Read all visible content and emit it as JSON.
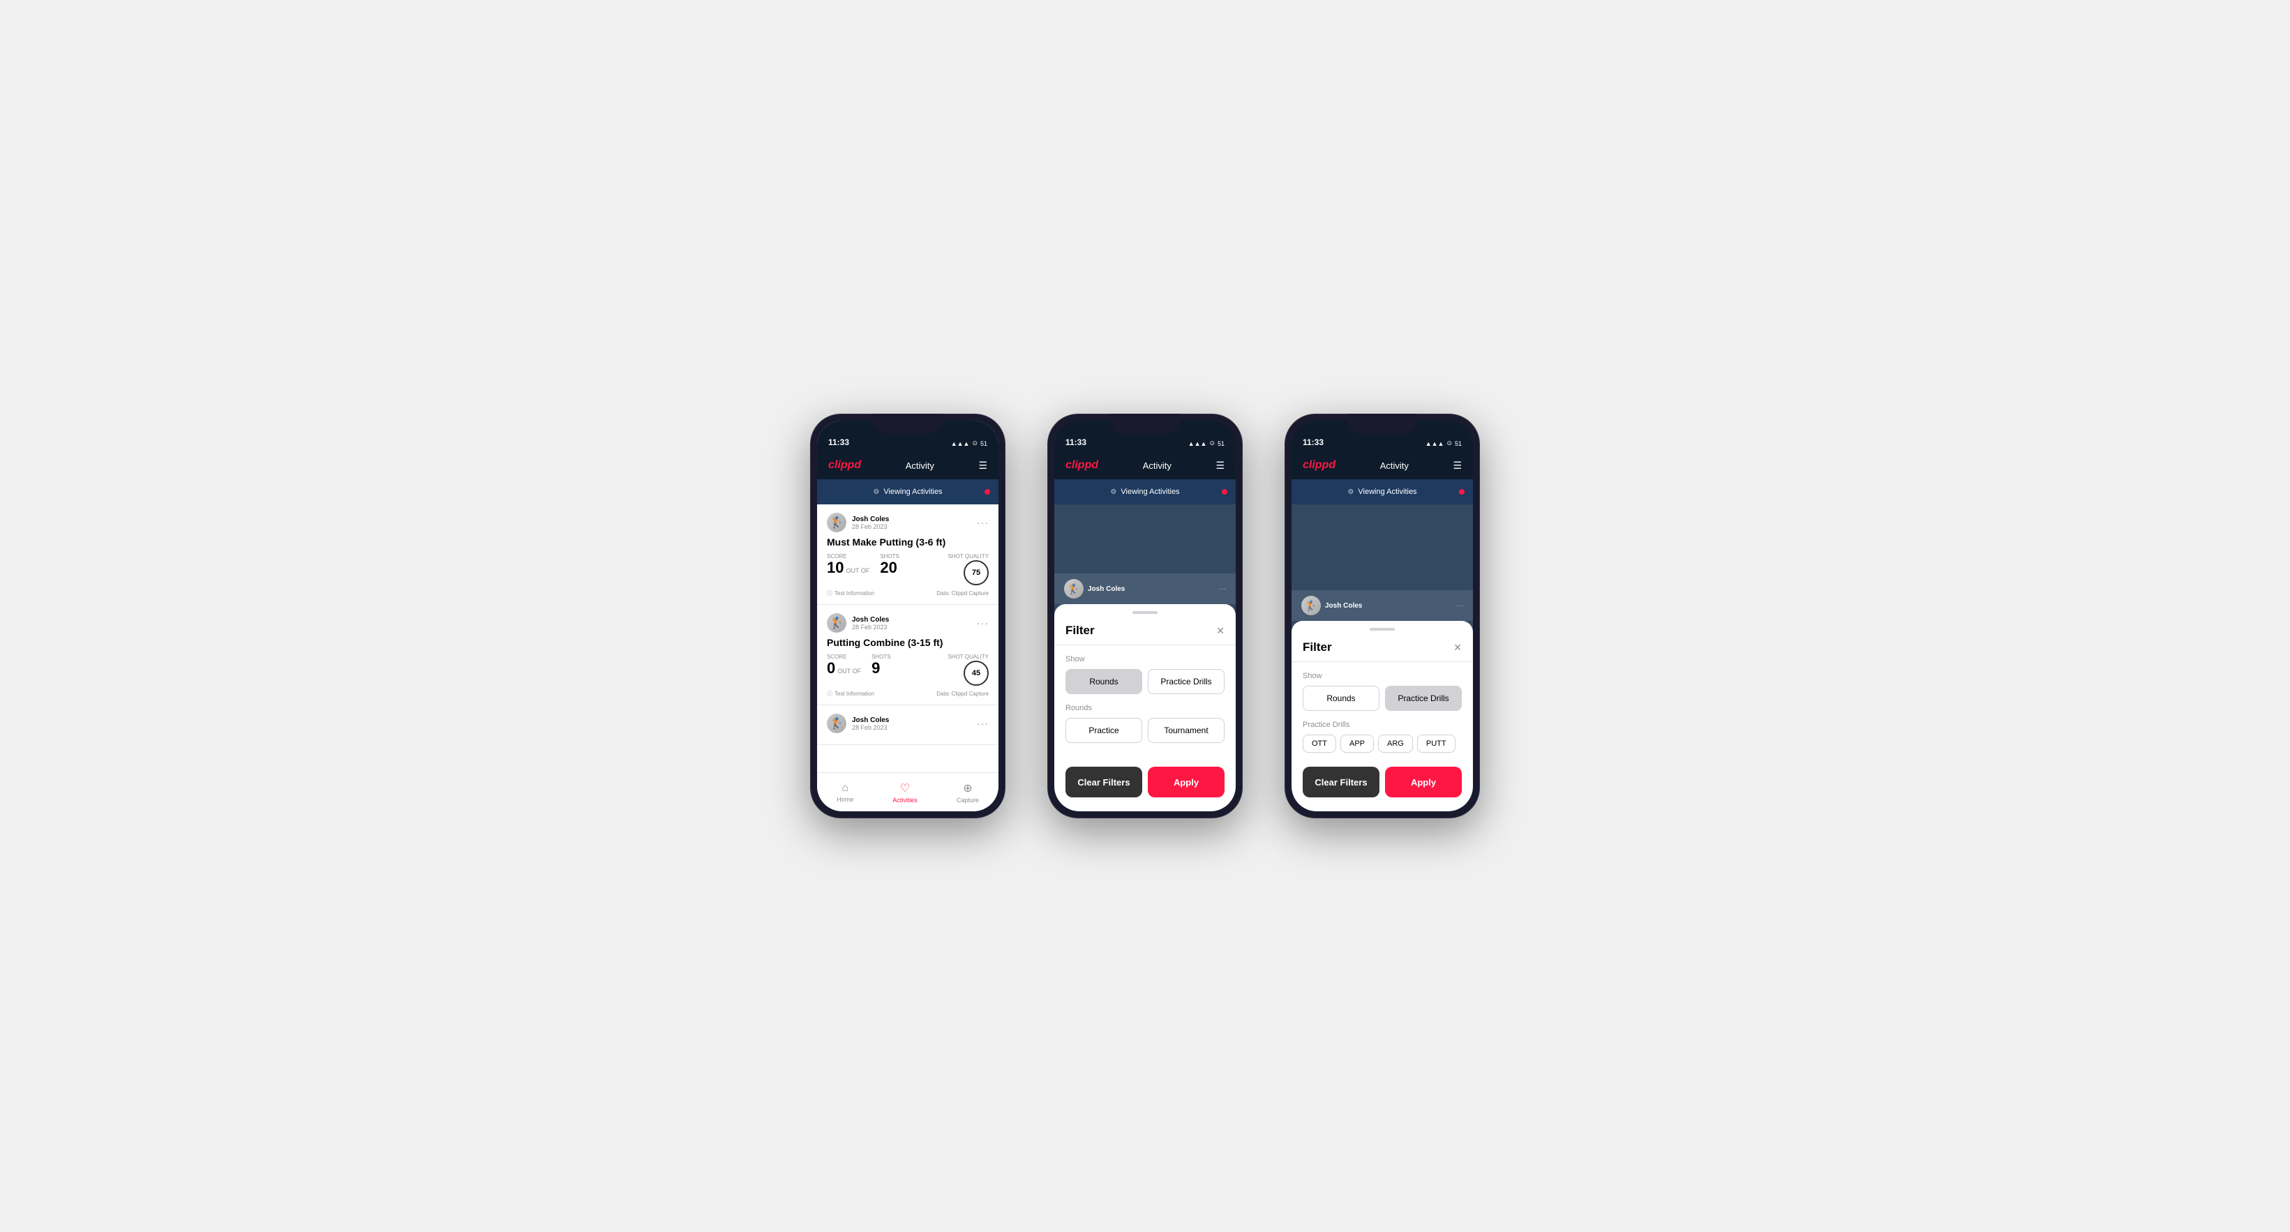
{
  "app": {
    "logo": "clippd",
    "nav_title": "Activity",
    "status_time": "11:33",
    "status_icons": "▲▲▲ ⊙ 51"
  },
  "phone1": {
    "viewing_bar": "Viewing Activities",
    "cards": [
      {
        "user_name": "Josh Coles",
        "user_date": "28 Feb 2023",
        "title": "Must Make Putting (3-6 ft)",
        "score_label": "Score",
        "score_value": "10",
        "out_of_label": "OUT OF",
        "shots_label": "Shots",
        "shots_value": "20",
        "shot_quality_label": "Shot Quality",
        "shot_quality_value": "75",
        "footer_info": "Test Information",
        "footer_data": "Data: Clippd Capture"
      },
      {
        "user_name": "Josh Coles",
        "user_date": "28 Feb 2023",
        "title": "Putting Combine (3-15 ft)",
        "score_label": "Score",
        "score_value": "0",
        "out_of_label": "OUT OF",
        "shots_label": "Shots",
        "shots_value": "9",
        "shot_quality_label": "Shot Quality",
        "shot_quality_value": "45",
        "footer_info": "Test Information",
        "footer_data": "Data: Clippd Capture"
      },
      {
        "user_name": "Josh Coles",
        "user_date": "28 Feb 2023",
        "title": "",
        "score_label": "",
        "score_value": "",
        "out_of_label": "",
        "shots_label": "",
        "shots_value": "",
        "shot_quality_label": "",
        "shot_quality_value": "",
        "footer_info": "",
        "footer_data": ""
      }
    ],
    "tabs": [
      {
        "label": "Home",
        "icon": "⌂",
        "active": false
      },
      {
        "label": "Activities",
        "icon": "♡",
        "active": true
      },
      {
        "label": "Capture",
        "icon": "⊕",
        "active": false
      }
    ]
  },
  "phone2": {
    "viewing_bar": "Viewing Activities",
    "filter": {
      "title": "Filter",
      "show_label": "Show",
      "rounds_btn": "Rounds",
      "practice_drills_btn": "Practice Drills",
      "rounds_section_label": "Rounds",
      "practice_btn": "Practice",
      "tournament_btn": "Tournament",
      "clear_filters_btn": "Clear Filters",
      "apply_btn": "Apply",
      "selected_show": "rounds"
    }
  },
  "phone3": {
    "viewing_bar": "Viewing Activities",
    "filter": {
      "title": "Filter",
      "show_label": "Show",
      "rounds_btn": "Rounds",
      "practice_drills_btn": "Practice Drills",
      "drills_section_label": "Practice Drills",
      "drill_btns": [
        "OTT",
        "APP",
        "ARG",
        "PUTT"
      ],
      "clear_filters_btn": "Clear Filters",
      "apply_btn": "Apply",
      "selected_show": "practice_drills"
    }
  }
}
